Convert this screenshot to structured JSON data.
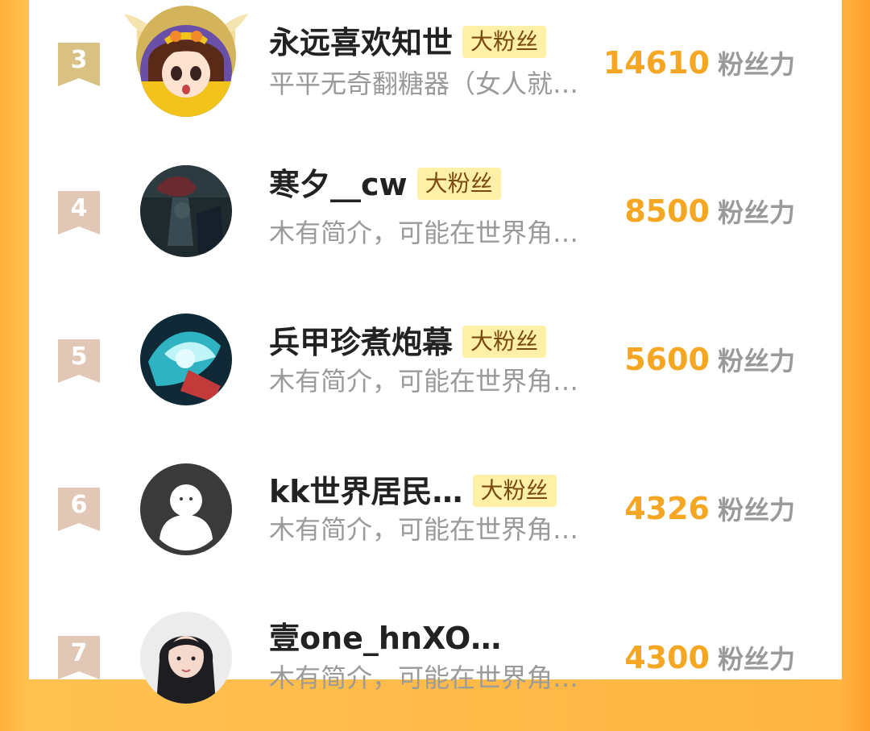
{
  "colors": {
    "accent_orange": "#f5a623",
    "badge_bg": "#fff0a8",
    "rank_gold": "#d9c083",
    "rank_bronze": "#e0c7b6",
    "side_orange": "#ffb13a"
  },
  "badge_label": "大粉丝",
  "score_unit": "粉丝力",
  "rows": [
    {
      "rank": "3",
      "name": "永远喜欢知世",
      "badge": "大粉丝",
      "desc": "平平无奇翻糖器（女人就…",
      "score": "14610",
      "unit": "粉丝力",
      "avatar_icon": "anime-girl-avatar-icon",
      "crown_icon": "wreath-crown-icon"
    },
    {
      "rank": "4",
      "name": "寒夕__cw",
      "badge": "大粉丝",
      "desc": "木有简介，可能在世界角…",
      "score": "8500",
      "unit": "粉丝力",
      "avatar_icon": "dark-scene-avatar-icon"
    },
    {
      "rank": "5",
      "name": "兵甲珍煮炮幕",
      "badge": "大粉丝",
      "desc": "木有简介，可能在世界角…",
      "score": "5600",
      "unit": "粉丝力",
      "avatar_icon": "cyan-art-avatar-icon"
    },
    {
      "rank": "6",
      "name": "kk世界居民…",
      "badge": "大粉丝",
      "desc": "木有简介，可能在世界角…",
      "score": "4326",
      "unit": "粉丝力",
      "avatar_icon": "default-user-avatar-icon"
    },
    {
      "rank": "7",
      "name": "壹one_hnXO…",
      "badge": "",
      "desc": "木有简介，可能在世界角…",
      "score": "4300",
      "unit": "粉丝力",
      "avatar_icon": "photo-girl-avatar-icon"
    }
  ]
}
